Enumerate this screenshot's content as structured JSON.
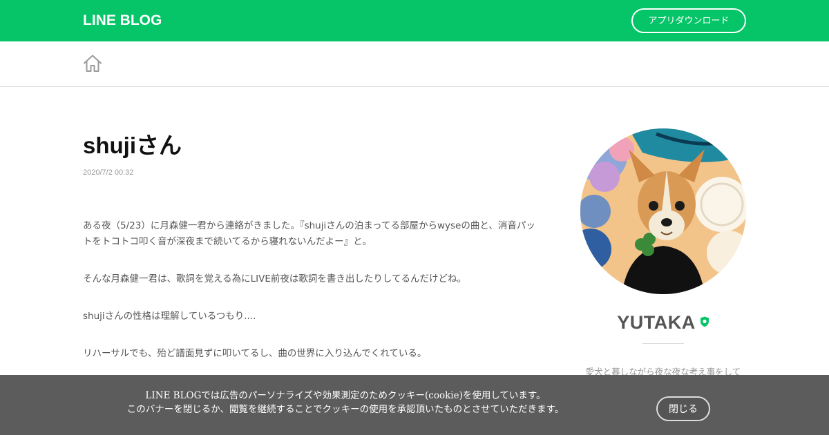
{
  "header": {
    "logo_text": "LINE BLOG",
    "app_download_label": "アプリダウンロード",
    "brand_color": "#06c568"
  },
  "subnav": {
    "home_icon": "home-icon"
  },
  "post": {
    "title": "shujiさん",
    "date": "2020/7/2 00:32",
    "paragraphs": [
      "ある夜（5/23）に月森健一君から連絡がきました。『shujiさんの泊まってる部屋からwyseの曲と、消音パットをトコトコ叩く音が深夜まで続いてるから寝れないんだよー』と。",
      "そんな月森健一君は、歌詞を覚える為にLIVE前夜は歌詞を書き出したりしてるんだけどね。",
      "shujiさんの性格は理解しているつもり....",
      "リハーサルでも、殆ど譜面見ずに叩いてるし、曲の世界に入り込んでくれている。"
    ]
  },
  "profile": {
    "name": "YUTAKA",
    "verified_icon": "verified-shield-icon",
    "description": "愛犬と暮しながら夜な夜な考え事をして"
  },
  "cookie_banner": {
    "line1": "LINE BLOGでは広告のパーソナライズや効果測定のためクッキー(cookie)を使用しています。",
    "line2": "このバナーを閉じるか、閲覧を継続することでクッキーの使用を承認頂いたものとさせていただきます。",
    "close_label": "閉じる"
  }
}
